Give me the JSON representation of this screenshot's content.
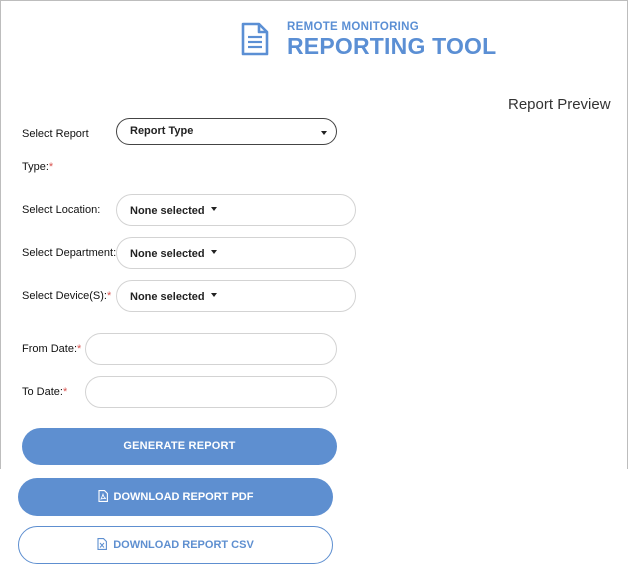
{
  "header": {
    "subtitle": "REMOTE MONITORING",
    "title": "REPORTING TOOL",
    "icon": "document-icon",
    "accent_color": "#5b8fd4"
  },
  "preview": {
    "label": "Report Preview"
  },
  "form": {
    "report_type": {
      "label_line1": "Select Report",
      "label_line2": "Type:",
      "required_mark": "*",
      "value": "Report Type"
    },
    "location": {
      "label": "Select Location:",
      "value": "None selected"
    },
    "department": {
      "label": "Select Department:",
      "value": "None selected"
    },
    "devices": {
      "label": "Select Device(S):",
      "required_mark": "*",
      "value": "None selected"
    },
    "from_date": {
      "label": "From Date:",
      "required_mark": "*",
      "value": ""
    },
    "to_date": {
      "label": "To Date:",
      "required_mark": "*",
      "value": ""
    }
  },
  "actions": {
    "generate": "GENERATE REPORT",
    "download_pdf": "DOWNLOAD REPORT PDF",
    "download_csv": "DOWNLOAD REPORT CSV",
    "primary_color": "#5e8fd0"
  }
}
